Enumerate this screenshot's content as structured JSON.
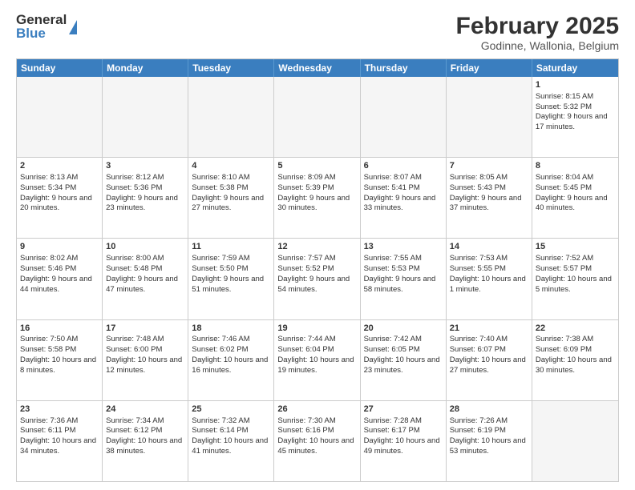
{
  "header": {
    "logo_general": "General",
    "logo_blue": "Blue",
    "month_title": "February 2025",
    "location": "Godinne, Wallonia, Belgium"
  },
  "days_of_week": [
    "Sunday",
    "Monday",
    "Tuesday",
    "Wednesday",
    "Thursday",
    "Friday",
    "Saturday"
  ],
  "weeks": [
    [
      {
        "day": "",
        "empty": true,
        "detail": ""
      },
      {
        "day": "",
        "empty": true,
        "detail": ""
      },
      {
        "day": "",
        "empty": true,
        "detail": ""
      },
      {
        "day": "",
        "empty": true,
        "detail": ""
      },
      {
        "day": "",
        "empty": true,
        "detail": ""
      },
      {
        "day": "",
        "empty": true,
        "detail": ""
      },
      {
        "day": "1",
        "empty": false,
        "detail": "Sunrise: 8:15 AM\nSunset: 5:32 PM\nDaylight: 9 hours and 17 minutes."
      }
    ],
    [
      {
        "day": "2",
        "empty": false,
        "detail": "Sunrise: 8:13 AM\nSunset: 5:34 PM\nDaylight: 9 hours and 20 minutes."
      },
      {
        "day": "3",
        "empty": false,
        "detail": "Sunrise: 8:12 AM\nSunset: 5:36 PM\nDaylight: 9 hours and 23 minutes."
      },
      {
        "day": "4",
        "empty": false,
        "detail": "Sunrise: 8:10 AM\nSunset: 5:38 PM\nDaylight: 9 hours and 27 minutes."
      },
      {
        "day": "5",
        "empty": false,
        "detail": "Sunrise: 8:09 AM\nSunset: 5:39 PM\nDaylight: 9 hours and 30 minutes."
      },
      {
        "day": "6",
        "empty": false,
        "detail": "Sunrise: 8:07 AM\nSunset: 5:41 PM\nDaylight: 9 hours and 33 minutes."
      },
      {
        "day": "7",
        "empty": false,
        "detail": "Sunrise: 8:05 AM\nSunset: 5:43 PM\nDaylight: 9 hours and 37 minutes."
      },
      {
        "day": "8",
        "empty": false,
        "detail": "Sunrise: 8:04 AM\nSunset: 5:45 PM\nDaylight: 9 hours and 40 minutes."
      }
    ],
    [
      {
        "day": "9",
        "empty": false,
        "detail": "Sunrise: 8:02 AM\nSunset: 5:46 PM\nDaylight: 9 hours and 44 minutes."
      },
      {
        "day": "10",
        "empty": false,
        "detail": "Sunrise: 8:00 AM\nSunset: 5:48 PM\nDaylight: 9 hours and 47 minutes."
      },
      {
        "day": "11",
        "empty": false,
        "detail": "Sunrise: 7:59 AM\nSunset: 5:50 PM\nDaylight: 9 hours and 51 minutes."
      },
      {
        "day": "12",
        "empty": false,
        "detail": "Sunrise: 7:57 AM\nSunset: 5:52 PM\nDaylight: 9 hours and 54 minutes."
      },
      {
        "day": "13",
        "empty": false,
        "detail": "Sunrise: 7:55 AM\nSunset: 5:53 PM\nDaylight: 9 hours and 58 minutes."
      },
      {
        "day": "14",
        "empty": false,
        "detail": "Sunrise: 7:53 AM\nSunset: 5:55 PM\nDaylight: 10 hours and 1 minute."
      },
      {
        "day": "15",
        "empty": false,
        "detail": "Sunrise: 7:52 AM\nSunset: 5:57 PM\nDaylight: 10 hours and 5 minutes."
      }
    ],
    [
      {
        "day": "16",
        "empty": false,
        "detail": "Sunrise: 7:50 AM\nSunset: 5:58 PM\nDaylight: 10 hours and 8 minutes."
      },
      {
        "day": "17",
        "empty": false,
        "detail": "Sunrise: 7:48 AM\nSunset: 6:00 PM\nDaylight: 10 hours and 12 minutes."
      },
      {
        "day": "18",
        "empty": false,
        "detail": "Sunrise: 7:46 AM\nSunset: 6:02 PM\nDaylight: 10 hours and 16 minutes."
      },
      {
        "day": "19",
        "empty": false,
        "detail": "Sunrise: 7:44 AM\nSunset: 6:04 PM\nDaylight: 10 hours and 19 minutes."
      },
      {
        "day": "20",
        "empty": false,
        "detail": "Sunrise: 7:42 AM\nSunset: 6:05 PM\nDaylight: 10 hours and 23 minutes."
      },
      {
        "day": "21",
        "empty": false,
        "detail": "Sunrise: 7:40 AM\nSunset: 6:07 PM\nDaylight: 10 hours and 27 minutes."
      },
      {
        "day": "22",
        "empty": false,
        "detail": "Sunrise: 7:38 AM\nSunset: 6:09 PM\nDaylight: 10 hours and 30 minutes."
      }
    ],
    [
      {
        "day": "23",
        "empty": false,
        "detail": "Sunrise: 7:36 AM\nSunset: 6:11 PM\nDaylight: 10 hours and 34 minutes."
      },
      {
        "day": "24",
        "empty": false,
        "detail": "Sunrise: 7:34 AM\nSunset: 6:12 PM\nDaylight: 10 hours and 38 minutes."
      },
      {
        "day": "25",
        "empty": false,
        "detail": "Sunrise: 7:32 AM\nSunset: 6:14 PM\nDaylight: 10 hours and 41 minutes."
      },
      {
        "day": "26",
        "empty": false,
        "detail": "Sunrise: 7:30 AM\nSunset: 6:16 PM\nDaylight: 10 hours and 45 minutes."
      },
      {
        "day": "27",
        "empty": false,
        "detail": "Sunrise: 7:28 AM\nSunset: 6:17 PM\nDaylight: 10 hours and 49 minutes."
      },
      {
        "day": "28",
        "empty": false,
        "detail": "Sunrise: 7:26 AM\nSunset: 6:19 PM\nDaylight: 10 hours and 53 minutes."
      },
      {
        "day": "",
        "empty": true,
        "detail": ""
      }
    ]
  ]
}
